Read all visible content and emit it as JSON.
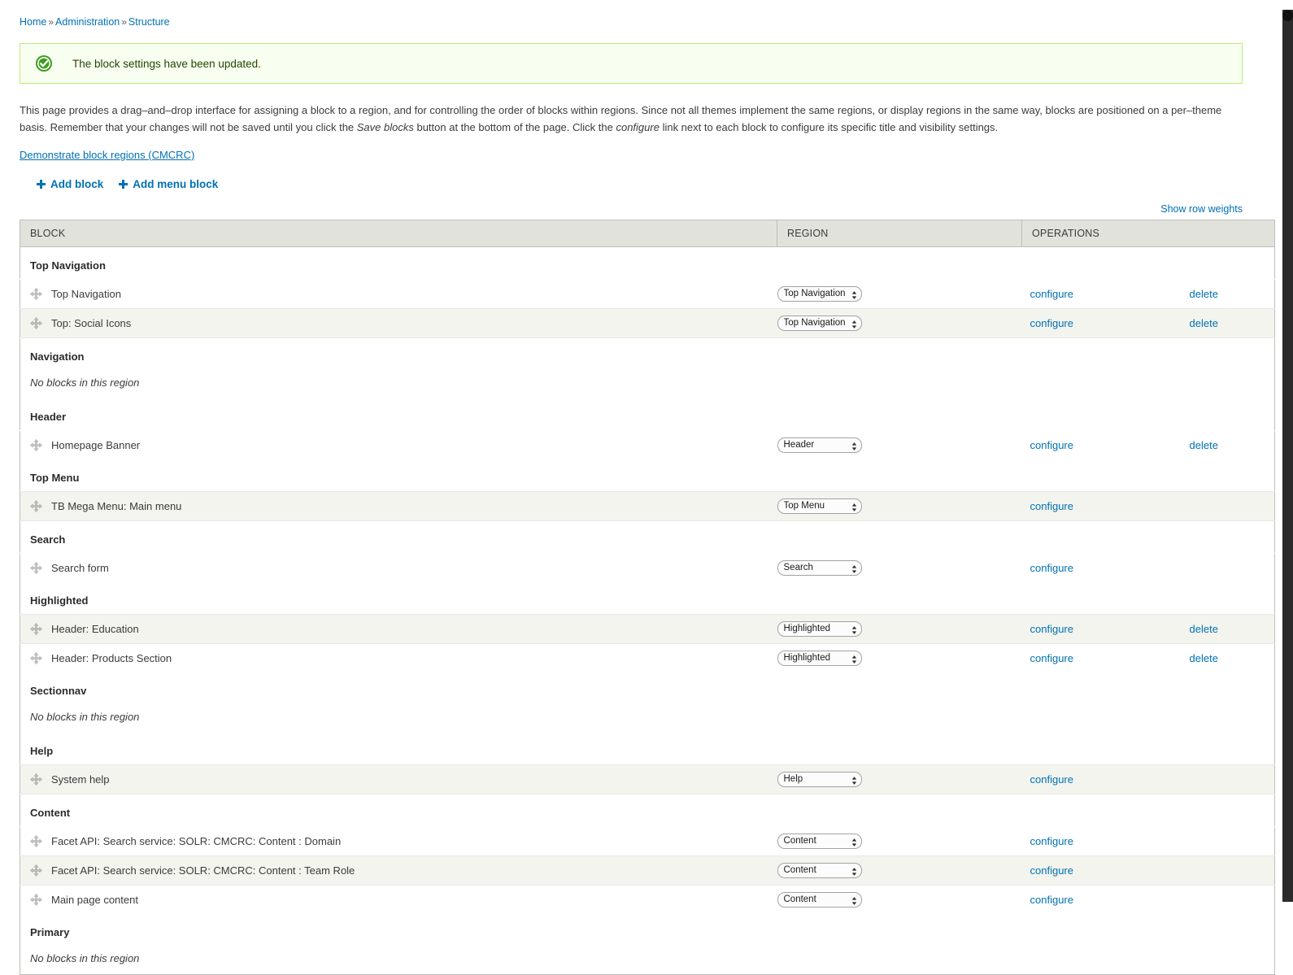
{
  "breadcrumb": {
    "items": [
      "Home",
      "Administration",
      "Structure"
    ],
    "separator": "»"
  },
  "status": {
    "icon": "check-circle-icon",
    "message": "The block settings have been updated.",
    "color": "#77bb22"
  },
  "description": {
    "part1": "This page provides a drag–and–drop interface for assigning a block to a region, and for controlling the order of blocks within regions. Since not all themes implement the same regions, or display regions in the same way, blocks are positioned on a per–theme basis. Remember that your changes will not be saved until you click the ",
    "emphasis1": "Save blocks",
    "part2": " button at the bottom of the page. Click the ",
    "emphasis2": "configure",
    "part3": " link next to each block to configure its specific title and visibility settings.",
    "demo_link": "Demonstrate block regions (CMCRC)"
  },
  "action_links": [
    {
      "label": "Add block",
      "icon": "plus-icon"
    },
    {
      "label": "Add menu block",
      "icon": "plus-icon"
    }
  ],
  "show_row_weights": "Show row weights",
  "table": {
    "headers": {
      "block": "BLOCK",
      "region": "REGION",
      "operations": "OPERATIONS"
    },
    "empty_region_text": "No blocks in this region",
    "ops": {
      "configure": "configure",
      "delete": "delete"
    },
    "regions": [
      {
        "name": "Top Navigation",
        "rows": [
          {
            "block": "Top Navigation",
            "region": "Top Navigation",
            "configure": true,
            "delete": true,
            "striped": false
          },
          {
            "block": "Top: Social Icons",
            "region": "Top Navigation",
            "configure": true,
            "delete": true,
            "striped": true
          }
        ]
      },
      {
        "name": "Navigation",
        "rows": []
      },
      {
        "name": "Header",
        "rows": [
          {
            "block": "Homepage Banner",
            "region": "Header",
            "configure": true,
            "delete": true,
            "striped": false
          }
        ]
      },
      {
        "name": "Top Menu",
        "rows": [
          {
            "block": "TB Mega Menu: Main menu",
            "region": "Top Menu",
            "configure": true,
            "delete": false,
            "striped": true
          }
        ]
      },
      {
        "name": "Search",
        "rows": [
          {
            "block": "Search form",
            "region": "Search",
            "configure": true,
            "delete": false,
            "striped": false
          }
        ]
      },
      {
        "name": "Highlighted",
        "rows": [
          {
            "block": "Header: Education",
            "region": "Highlighted",
            "configure": true,
            "delete": true,
            "striped": true
          },
          {
            "block": "Header: Products Section",
            "region": "Highlighted",
            "configure": true,
            "delete": true,
            "striped": false
          }
        ]
      },
      {
        "name": "Sectionnav",
        "rows": []
      },
      {
        "name": "Help",
        "rows": [
          {
            "block": "System help",
            "region": "Help",
            "configure": true,
            "delete": false,
            "striped": true
          }
        ]
      },
      {
        "name": "Content",
        "rows": [
          {
            "block": "Facet API: Search service: SOLR: CMCRC: Content : Domain",
            "region": "Content",
            "configure": true,
            "delete": false,
            "striped": false
          },
          {
            "block": "Facet API: Search service: SOLR: CMCRC: Content : Team Role",
            "region": "Content",
            "configure": true,
            "delete": false,
            "striped": true
          },
          {
            "block": "Main page content",
            "region": "Content",
            "configure": true,
            "delete": false,
            "striped": false
          }
        ]
      },
      {
        "name": "Primary",
        "rows": []
      }
    ]
  }
}
